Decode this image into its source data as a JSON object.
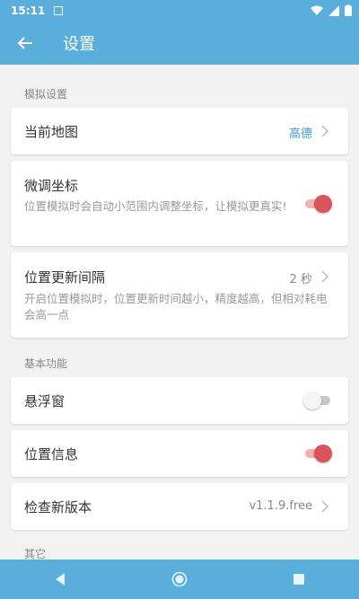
{
  "status": {
    "time": "15:11"
  },
  "app": {
    "title": "设置"
  },
  "sections": {
    "simulate": "模拟设置",
    "basic": "基本功能",
    "other": "其它"
  },
  "items": {
    "map": {
      "title": "当前地图",
      "value": "高德"
    },
    "fine_tune": {
      "title": "微调坐标",
      "desc": "位置模拟时会自动小范围内调整坐标，让模拟更真实!",
      "enabled": true
    },
    "interval": {
      "title": "位置更新间隔",
      "value": "2 秒",
      "desc": "开启位置模拟时，位置更新时间越小，精度越高，但相对耗电会高一点"
    },
    "floating": {
      "title": "悬浮窗",
      "enabled": false
    },
    "location_info": {
      "title": "位置信息",
      "enabled": true
    },
    "update": {
      "title": "检查新版本",
      "value": "v1.1.9.free"
    }
  },
  "colors": {
    "primary": "#5aaedc",
    "toggle_on": "#d9545a",
    "link": "#3a9ad9"
  }
}
